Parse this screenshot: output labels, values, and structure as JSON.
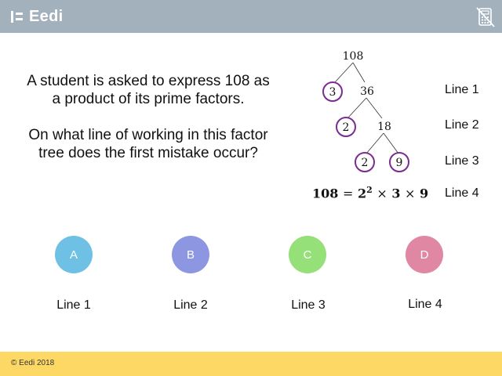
{
  "header": {
    "brand": "Eedi",
    "calculator_icon": "calculator-crossed-icon",
    "background_color": "#a3b1bd"
  },
  "question": {
    "paragraph1": "A student is asked to express 108 as a product of its prime factors.",
    "paragraph2": "On what line of working in this factor tree does the first mistake occur?"
  },
  "factor_tree": {
    "root": "108",
    "line1": [
      "3",
      "36"
    ],
    "line2": [
      "2",
      "18"
    ],
    "line3": [
      "2",
      "9"
    ],
    "circle_color": "#7b2c8f"
  },
  "equation": {
    "lhs": "108",
    "equals": "=",
    "base": "2",
    "exponent": "2",
    "times1": "×",
    "factor2": "3",
    "times2": "×",
    "factor3": "9"
  },
  "line_labels": [
    "Line 1",
    "Line 2",
    "Line 3",
    "Line 4"
  ],
  "options": [
    {
      "letter": "A",
      "answer": "Line 1",
      "color": "#6ec1e4"
    },
    {
      "letter": "B",
      "answer": "Line 2",
      "color": "#8c96e1"
    },
    {
      "letter": "C",
      "answer": "Line 3",
      "color": "#96e079"
    },
    {
      "letter": "D",
      "answer": "Line 4",
      "color": "#e087a3"
    }
  ],
  "footer": {
    "copyright": "© Eedi 2018",
    "background_color": "#fed865"
  }
}
